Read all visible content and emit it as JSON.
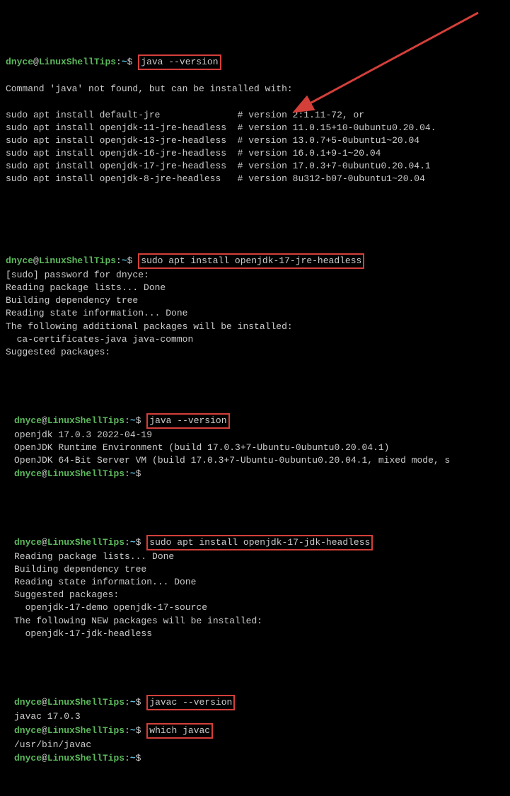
{
  "blocks": [
    {
      "prompt": {
        "user": "dnyce",
        "host": "LinuxShellTips",
        "path": "~"
      },
      "cmd": "java --version",
      "highlighted": true,
      "output": [
        "",
        "Command 'java' not found, but can be installed with:",
        "",
        "sudo apt install default-jre              # version 2:1.11-72, or",
        "sudo apt install openjdk-11-jre-headless  # version 11.0.15+10-0ubuntu0.20.04.",
        "sudo apt install openjdk-13-jre-headless  # version 13.0.7+5-0ubuntu1~20.04",
        "sudo apt install openjdk-16-jre-headless  # version 16.0.1+9-1~20.04",
        "sudo apt install openjdk-17-jre-headless  # version 17.0.3+7-0ubuntu0.20.04.1",
        "sudo apt install openjdk-8-jre-headless   # version 8u312-b07-0ubuntu1~20.04",
        ""
      ]
    },
    {
      "prompt": {
        "user": "dnyce",
        "host": "LinuxShellTips",
        "path": "~"
      },
      "cmd": "sudo apt install openjdk-17-jre-headless",
      "highlighted": true,
      "output": [
        "[sudo] password for dnyce:",
        "Reading package lists... Done",
        "Building dependency tree",
        "Reading state information... Done",
        "The following additional packages will be installed:",
        "  ca-certificates-java java-common",
        "Suggested packages:"
      ]
    },
    {
      "inset": true,
      "prompts": [
        {
          "user": "dnyce",
          "host": "LinuxShellTips",
          "path": "~",
          "cmd": "java --version",
          "highlighted": true
        }
      ],
      "output": [
        "openjdk 17.0.3 2022-04-19",
        "OpenJDK Runtime Environment (build 17.0.3+7-Ubuntu-0ubuntu0.20.04.1)",
        "OpenJDK 64-Bit Server VM (build 17.0.3+7-Ubuntu-0ubuntu0.20.04.1, mixed mode, s"
      ],
      "trailing_prompt": {
        "user": "dnyce",
        "host": "LinuxShellTips",
        "path": "~"
      }
    },
    {
      "inset": true,
      "prompts": [
        {
          "user": "dnyce",
          "host": "LinuxShellTips",
          "path": "~",
          "cmd": "sudo apt install openjdk-17-jdk-headless",
          "highlighted": true
        }
      ],
      "output": [
        "Reading package lists... Done",
        "Building dependency tree",
        "Reading state information... Done",
        "Suggested packages:",
        "  openjdk-17-demo openjdk-17-source",
        "The following NEW packages will be installed:",
        "  openjdk-17-jdk-headless"
      ]
    },
    {
      "inset": true,
      "multi": [
        {
          "type": "prompt",
          "user": "dnyce",
          "host": "LinuxShellTips",
          "path": "~",
          "cmd": "javac --version",
          "highlighted": true
        },
        {
          "type": "output",
          "text": "javac 17.0.3"
        },
        {
          "type": "prompt",
          "user": "dnyce",
          "host": "LinuxShellTips",
          "path": "~",
          "cmd": "which javac",
          "highlighted": true
        },
        {
          "type": "output",
          "text": "/usr/bin/javac"
        },
        {
          "type": "prompt",
          "user": "dnyce",
          "host": "LinuxShellTips",
          "path": "~",
          "cmd": "",
          "highlighted": false
        }
      ]
    }
  ],
  "arrow_color": "#d43f3a"
}
